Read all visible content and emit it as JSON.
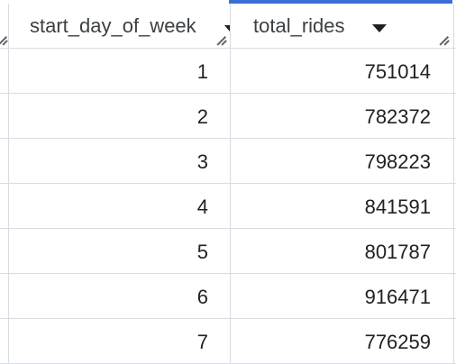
{
  "columns": {
    "day": {
      "label": "start_day_of_week"
    },
    "rides": {
      "label": "total_rides"
    }
  },
  "rows": [
    {
      "day": "1",
      "rides": "751014"
    },
    {
      "day": "2",
      "rides": "782372"
    },
    {
      "day": "3",
      "rides": "798223"
    },
    {
      "day": "4",
      "rides": "841591"
    },
    {
      "day": "5",
      "rides": "801787"
    },
    {
      "day": "6",
      "rides": "916471"
    },
    {
      "day": "7",
      "rides": "776259"
    }
  ],
  "colors": {
    "accent": "#3b6fd4",
    "border": "#d9dce1"
  },
  "icons": {
    "sort": "sort-descending-icon",
    "resize": "column-resize-icon"
  }
}
